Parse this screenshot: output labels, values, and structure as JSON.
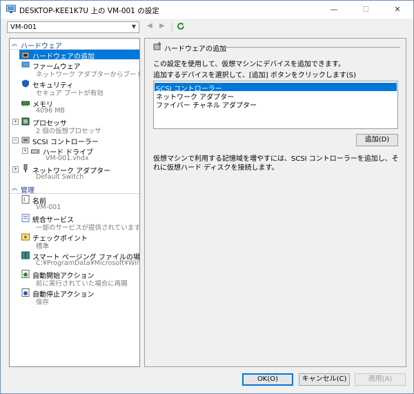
{
  "window": {
    "title": "DESKTOP-KEE1K7U 上の VM-001 の設定"
  },
  "vm_selector": {
    "value": "VM-001"
  },
  "sidebar": {
    "hardware_header": "ハードウェア",
    "management_header": "管理",
    "hardware_items": [
      {
        "label": "ハードウェアの追加",
        "sub": ""
      },
      {
        "label": "ファームウェア",
        "sub": "ネットワーク アダプターからブート"
      },
      {
        "label": "セキュリティ",
        "sub": "セキュア ブートが有効"
      },
      {
        "label": "メモリ",
        "sub": "4096 MB"
      },
      {
        "label": "プロセッサ",
        "sub": "2 個の仮想プロセッサ"
      },
      {
        "label": "SCSI コントローラー",
        "sub": ""
      },
      {
        "label": "ハード ドライブ",
        "sub": "VM-001.vhdx"
      },
      {
        "label": "ネットワーク アダプター",
        "sub": "Default Switch"
      }
    ],
    "management_items": [
      {
        "label": "名前",
        "sub": "VM-001"
      },
      {
        "label": "統合サービス",
        "sub": "一部のサービスが提供されています"
      },
      {
        "label": "チェックポイント",
        "sub": "標準"
      },
      {
        "label": "スマート ページング ファイルの場所",
        "sub": "C:¥ProgramData¥Microsoft¥Windo..."
      },
      {
        "label": "自動開始アクション",
        "sub": "前に実行されていた場合に再開"
      },
      {
        "label": "自動停止アクション",
        "sub": "保存"
      }
    ]
  },
  "panel": {
    "header": "ハードウェアの追加",
    "desc1": "この設定を使用して、仮想マシンにデバイスを追加できます。",
    "desc2": "追加するデバイスを選択して、[追加] ボタンをクリックします(S)",
    "devices": [
      "SCSI コントローラー",
      "ネットワーク アダプター",
      "ファイバー チャネル アダプター"
    ],
    "add_button": "追加(D)",
    "info": "仮想マシンで利用する記憶域を増やすには、SCSI コントローラーを追加し、それに仮想ハード ディスクを接続します。"
  },
  "footer": {
    "ok": "OK(O)",
    "cancel": "キャンセル(C)",
    "apply": "適用(A)"
  },
  "colors": {
    "selection": "#0078d7",
    "header_text": "#1f3f8f"
  }
}
